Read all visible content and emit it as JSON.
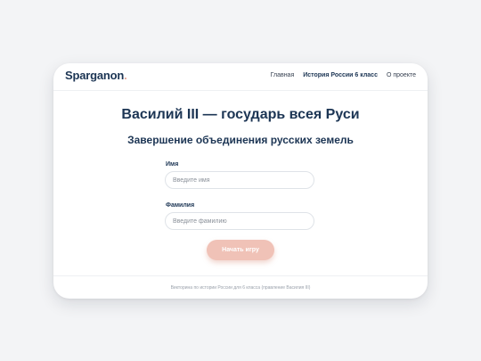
{
  "header": {
    "logo": "Sparganon",
    "logo_dot": ".",
    "nav": [
      {
        "label": "Главная"
      },
      {
        "label": "История России 6 класс"
      },
      {
        "label": "О проекте"
      }
    ]
  },
  "main": {
    "title": "Василий III — государь всея Руси",
    "subtitle": "Завершение объединения русских земель",
    "form": {
      "first_name": {
        "label": "Имя",
        "placeholder": "Введите имя",
        "value": ""
      },
      "last_name": {
        "label": "Фамилия",
        "placeholder": "Введите фамилию",
        "value": ""
      },
      "submit_label": "Начать игру"
    }
  },
  "footer": {
    "text": "Викторина по истории России для 6 класса (правление Василия III)"
  },
  "colors": {
    "page_background": "#f3f4f6",
    "card_background": "#ffffff",
    "primary_text": "#1c3554",
    "accent": "#f0c2b7",
    "logo_dot": "#e8a99a",
    "muted_text": "#9aa1ab"
  }
}
